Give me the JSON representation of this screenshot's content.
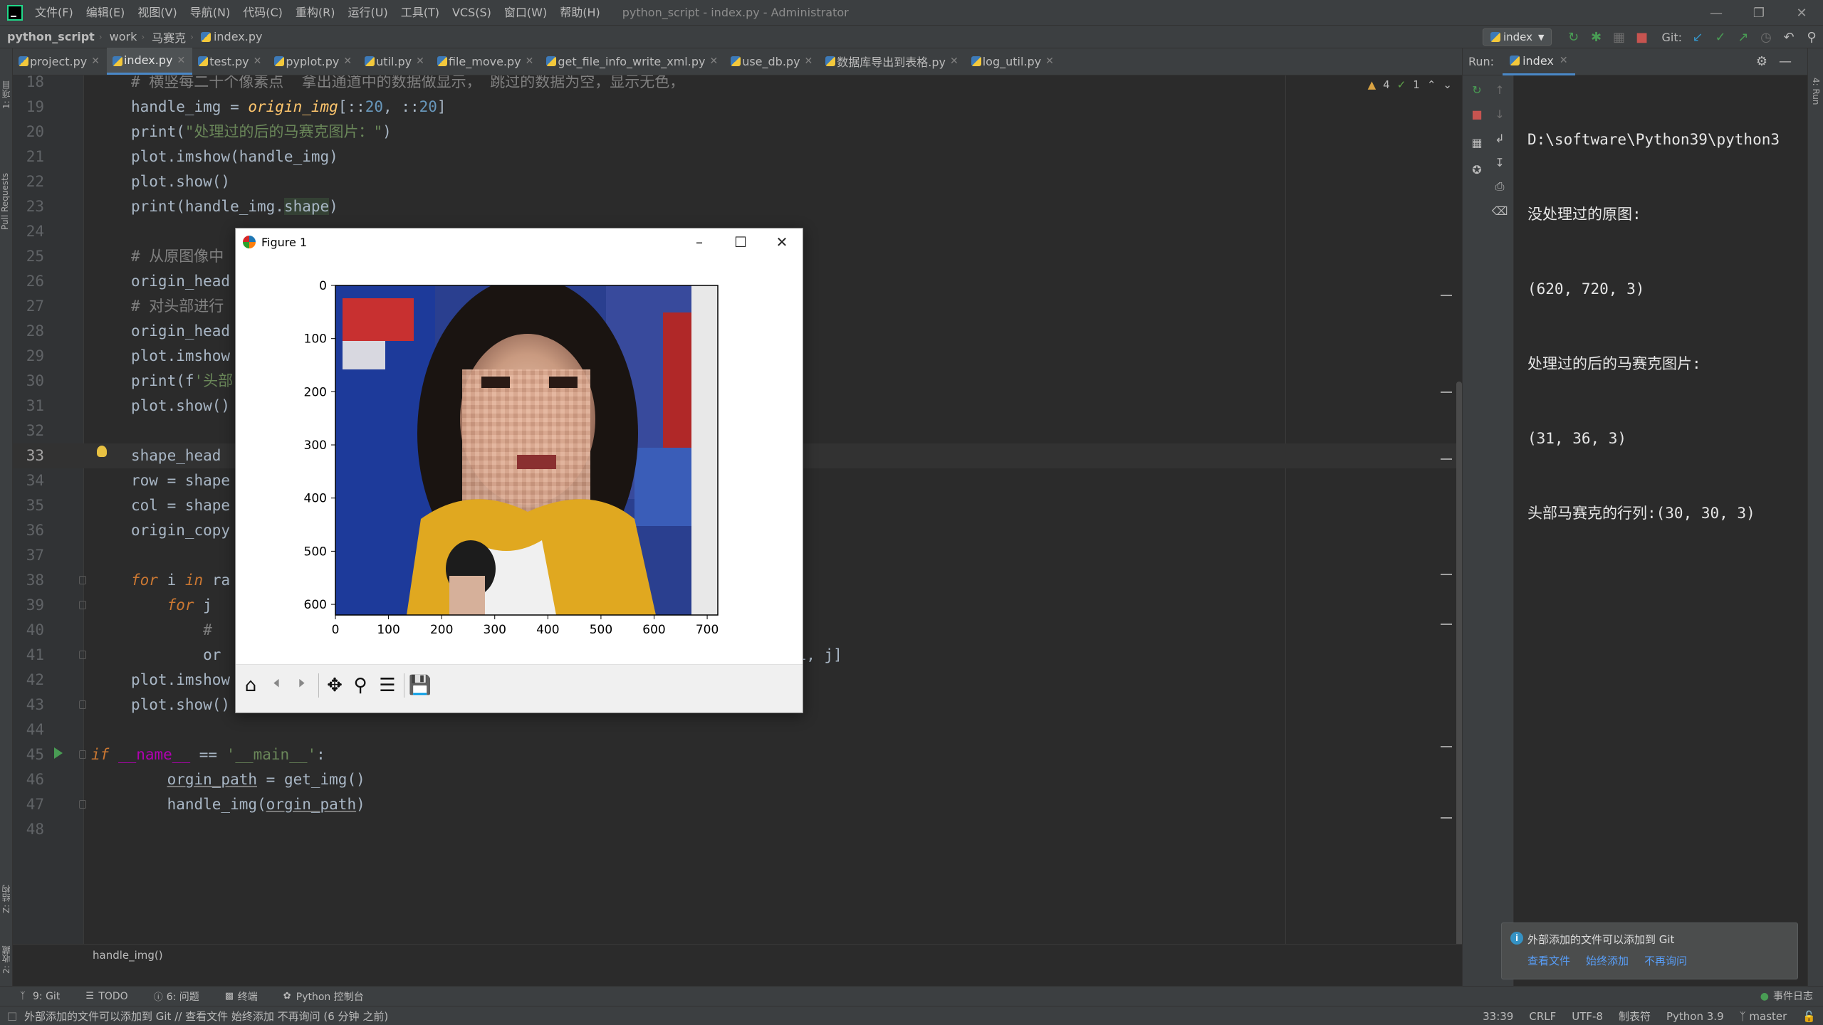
{
  "menubar": {
    "items": [
      "文件(F)",
      "编辑(E)",
      "视图(V)",
      "导航(N)",
      "代码(C)",
      "重构(R)",
      "运行(U)",
      "工具(T)",
      "VCS(S)",
      "窗口(W)",
      "帮助(H)"
    ],
    "window_title": "python_script - index.py - Administrator"
  },
  "navbar": {
    "crumbs": [
      "python_script",
      "work",
      "马赛克",
      "index.py"
    ],
    "run_config": "index",
    "git_label": "Git:"
  },
  "editor_tabs": [
    {
      "label": "project.py",
      "active": false
    },
    {
      "label": "index.py",
      "active": true
    },
    {
      "label": "test.py",
      "active": false
    },
    {
      "label": "pyplot.py",
      "active": false
    },
    {
      "label": "util.py",
      "active": false
    },
    {
      "label": "file_move.py",
      "active": false
    },
    {
      "label": "get_file_info_write_xml.py",
      "active": false
    },
    {
      "label": "use_db.py",
      "active": false
    },
    {
      "label": "数据库导出到表格.py",
      "active": false
    },
    {
      "label": "log_util.py",
      "active": false
    }
  ],
  "inspection": {
    "warnings": "4",
    "ok": "1"
  },
  "code_lines": [
    {
      "n": "18",
      "html": "<span class=\"cmt\"># 横竖每二十个像素点  拿出通道中的数据做显示， 跳过的数据为空，显示无色，</span>"
    },
    {
      "n": "19",
      "html": "handle_img = <span class=\"ital\">origin_img</span>[::<span class=\"num\">20</span>, ::<span class=\"num\">20</span>]"
    },
    {
      "n": "20",
      "html": "print(<span class=\"str\">\"处理过的后的马赛克图片：\"</span>)"
    },
    {
      "n": "21",
      "html": "plot.imshow(handle_img)"
    },
    {
      "n": "22",
      "html": "plot.show()"
    },
    {
      "n": "23",
      "html": "print(handle_img.<span class=\"hl\">shape</span>)"
    },
    {
      "n": "24",
      "html": ""
    },
    {
      "n": "25",
      "html": "<span class=\"cmt\"># 从原图像中</span>"
    },
    {
      "n": "26",
      "html": "origin_head"
    },
    {
      "n": "27",
      "html": "<span class=\"cmt\"># 对头部进行</span>"
    },
    {
      "n": "28",
      "html": "origin_head"
    },
    {
      "n": "29",
      "html": "plot.imshow"
    },
    {
      "n": "30",
      "html": "print(f<span class=\"str\">'头部</span>"
    },
    {
      "n": "31",
      "html": "plot.show()"
    },
    {
      "n": "32",
      "html": ""
    },
    {
      "n": "33",
      "html": "shape_head"
    },
    {
      "n": "34",
      "html": "row = shape"
    },
    {
      "n": "35",
      "html": "col = shape"
    },
    {
      "n": "36",
      "html": "origin_copy"
    },
    {
      "n": "37",
      "html": ""
    },
    {
      "n": "38",
      "html": "<span class=\"kw\">for</span> i <span class=\"kw\">in</span> ra"
    },
    {
      "n": "39",
      "html": "    <span class=\"kw\">for</span> j"
    },
    {
      "n": "40",
      "html": "        <span class=\"cmt\">#</span>                                                    <span class=\"str\">g</span>"
    },
    {
      "n": "41",
      "html": "        or                                                   gin_head_img[i, j]"
    },
    {
      "n": "42",
      "html": "plot.imshow"
    },
    {
      "n": "43",
      "html": "plot.show()"
    },
    {
      "n": "44",
      "html": ""
    },
    {
      "n": "45",
      "html": "<span class=\"kw\">if</span> <span class=\"magic\">__name__</span> == <span class=\"str\">'__main__'</span>:"
    },
    {
      "n": "46",
      "html": "    <span class=\"ul\">orgin_path</span> = get_img()"
    },
    {
      "n": "47",
      "html": "    handle_img(<span class=\"ul\">orgin_path</span>)"
    },
    {
      "n": "48",
      "html": ""
    }
  ],
  "editor_breadcrumb": "handle_img()",
  "run_panel": {
    "label": "Run:",
    "tab": "index",
    "console_lines": [
      "D:\\software\\Python39\\python3",
      "没处理过的原图:",
      "(620, 720, 3)",
      "处理过的后的马赛克图片:",
      "(31, 36, 3)",
      "头部马赛克的行列:(30, 30, 3)"
    ]
  },
  "figure": {
    "title": "Figure 1",
    "x_ticks": [
      "0",
      "100",
      "200",
      "300",
      "400",
      "500",
      "600",
      "700"
    ],
    "y_ticks": [
      "0",
      "100",
      "200",
      "300",
      "400",
      "500",
      "600"
    ],
    "xlim": [
      0,
      720
    ],
    "ylim": [
      620,
      0
    ]
  },
  "notification": {
    "text": "外部添加的文件可以添加到 Git",
    "actions": [
      "查看文件",
      "始终添加",
      "不再询问"
    ]
  },
  "bottom_tools": [
    {
      "icon": "git",
      "label": "9: Git"
    },
    {
      "icon": "todo",
      "label": "TODO"
    },
    {
      "icon": "problems",
      "label": "6: 问题"
    },
    {
      "icon": "terminal",
      "label": "终端"
    },
    {
      "icon": "python-console",
      "label": "Python 控制台"
    }
  ],
  "event_log": "事件日志",
  "left_strip": {
    "project": "1: 项目",
    "pull_requests": "Pull Requests",
    "structure": "Z: 结构",
    "favorites": "2: 收藏"
  },
  "right_strip": {
    "run": "4: Run"
  },
  "status": {
    "message": "外部添加的文件可以添加到 Git // 查看文件  始终添加  不再询问 (6 分钟 之前)",
    "position": "33:39",
    "line_sep": "CRLF",
    "encoding": "UTF-8",
    "indent": "制表符",
    "interpreter": "Python 3.9",
    "branch": "master"
  },
  "colors": {
    "accent": "#4a88c7",
    "run_green": "#499c54",
    "stop_red": "#c75450"
  }
}
